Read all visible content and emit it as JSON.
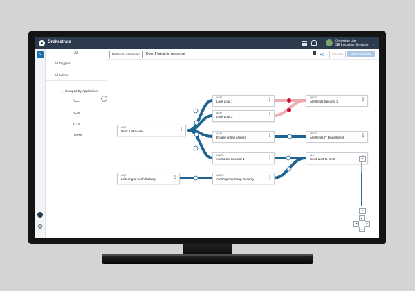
{
  "topbar": {
    "app_name": "Orchestrate",
    "user_name": "Orchestrate User",
    "user_org": "SE Location Services",
    "user_caret": "▾"
  },
  "rail": {
    "workflow_icon": "⌥",
    "settings_icon": "⚙"
  },
  "sidebar": {
    "title": "All",
    "items": [
      "All Triggers",
      "All Actions",
      "Grouped By Application"
    ],
    "caret": "▾",
    "collapse": "‹",
    "applications": [
      "ACC",
      "ACM",
      "ALLY",
      "UNITS"
    ]
  },
  "toolbar": {
    "return_label": "Return to dashboard",
    "workflow_title": "Door 1 break-in response",
    "toggle_glyph": "■◧",
    "discard_label": "Discard",
    "save_label": "Save workflow"
  },
  "nodes": {
    "door1": {
      "app": "ACC",
      "name": "Door 1 intrusion"
    },
    "lock1": {
      "app": "ACM",
      "name": "Lock door 1"
    },
    "lock2": {
      "app": "ACM",
      "name": "Lock door 2"
    },
    "camera": {
      "app": "ACM",
      "name": "Enable N hall camera"
    },
    "sec1": {
      "app": "UNITS",
      "name": "AlertUnits Security 1"
    },
    "sec2": {
      "app": "UNITS",
      "name": "AlertUnits Security 2"
    },
    "itdept": {
      "app": "UNITS",
      "name": "AlertUnits IT Department"
    },
    "cad": {
      "app": "ALLY",
      "name": "Send alert to CAD"
    },
    "loiter": {
      "app": "ACC",
      "name": "Loitering at north hallway"
    },
    "agency": {
      "app": "UNITS",
      "name": "AlertAgencyGroup Security"
    },
    "menu_glyph": "⋮"
  },
  "zoom": {
    "plus": "+",
    "minus": "−",
    "level": 0.75
  },
  "pan": {
    "up": "▲",
    "left": "◀",
    "right": "▶",
    "down": "▼"
  },
  "colors": {
    "link": "#1d6493",
    "error_link": "#f0aab2",
    "error_dot": "#c8102e",
    "topbar": "#2d3b4e"
  }
}
